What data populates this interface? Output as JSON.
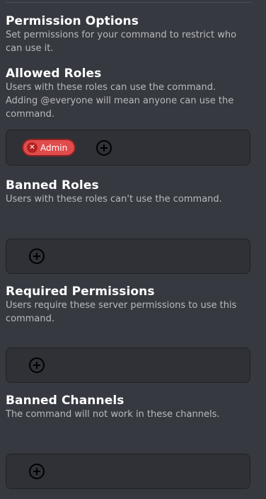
{
  "permission_options": {
    "title": "Permission Options",
    "description": "Set permissions for your command to restrict who can use it."
  },
  "allowed_roles": {
    "title": "Allowed Roles",
    "description": "Users with these roles can use the command. Adding @everyone will mean anyone can use the command.",
    "roles": [
      {
        "label": "Admin",
        "remove_icon": "close-circle-icon",
        "color": "#e04b4b"
      }
    ],
    "add_icon": "plus-circle-icon"
  },
  "banned_roles": {
    "title": "Banned Roles",
    "description": "Users with these roles can't use the command.",
    "add_icon": "plus-circle-icon"
  },
  "required_permissions": {
    "title": "Required Permissions",
    "description": "Users require these server permissions to use this command.",
    "add_icon": "plus-circle-icon"
  },
  "banned_channels": {
    "title": "Banned Channels",
    "description": "The command will not work in these channels.",
    "add_icon": "plus-circle-icon"
  },
  "colors": {
    "background": "#36393f",
    "box_background": "#2f3136",
    "role_chip": "#e04b4b"
  }
}
